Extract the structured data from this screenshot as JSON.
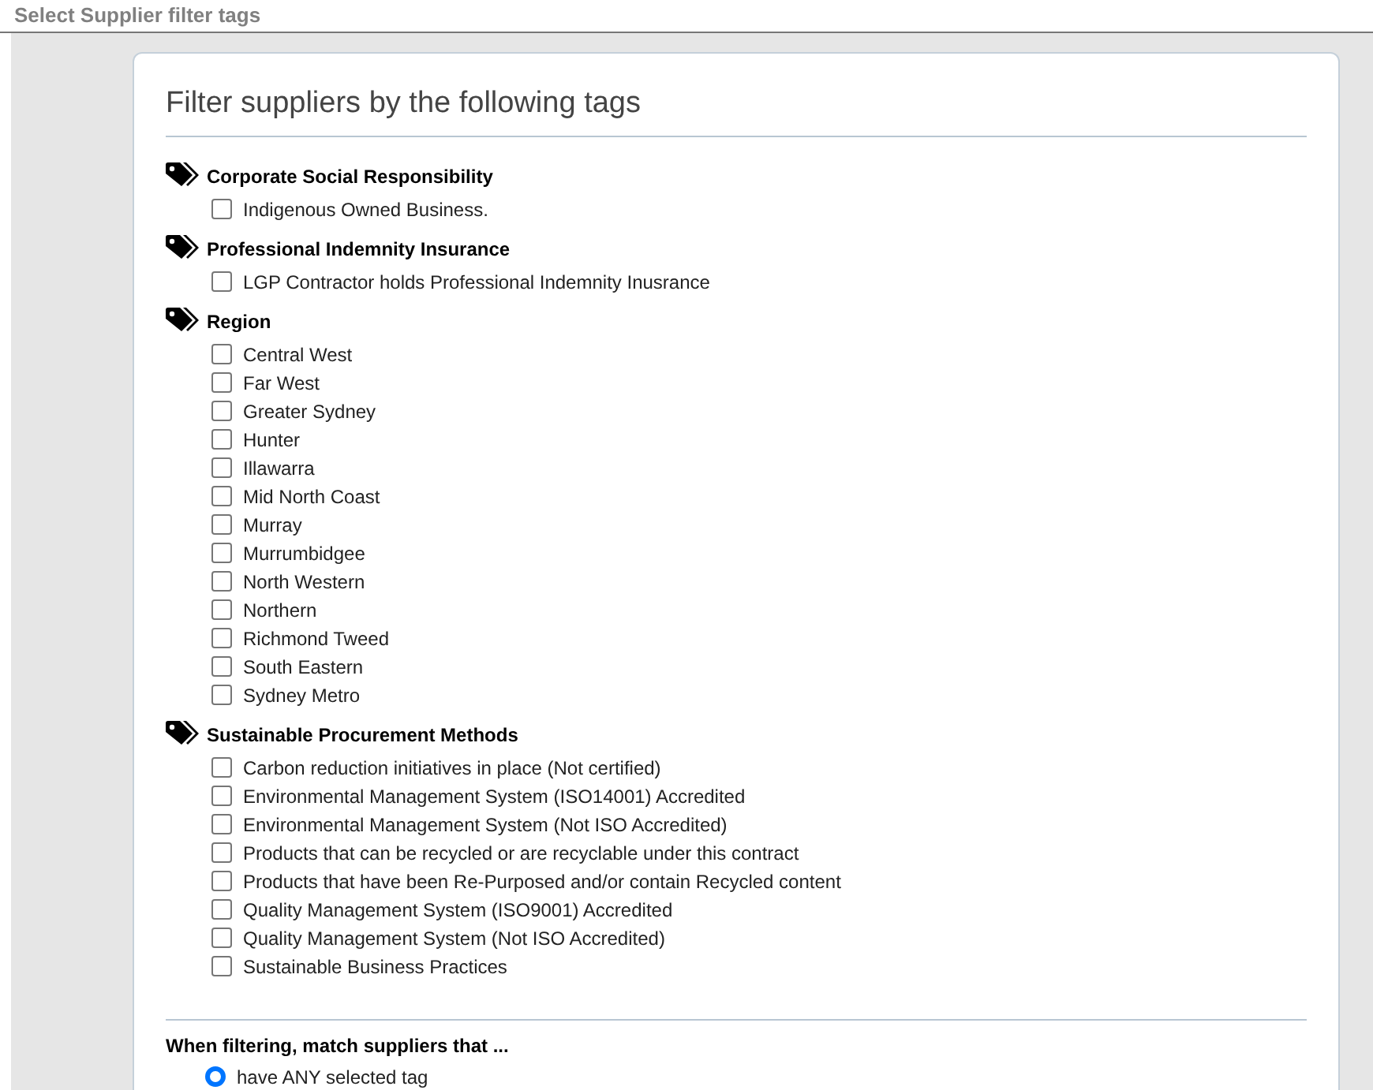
{
  "page_title": "Select Supplier filter tags",
  "card_title": "Filter suppliers by the following tags",
  "groups": [
    {
      "name": "Corporate Social Responsibility",
      "items": [
        {
          "label": "Indigenous Owned Business.",
          "checked": false
        }
      ]
    },
    {
      "name": "Professional Indemnity Insurance",
      "items": [
        {
          "label": "LGP Contractor holds Professional Indemnity Inusrance",
          "checked": false
        }
      ]
    },
    {
      "name": "Region",
      "items": [
        {
          "label": "Central West",
          "checked": false
        },
        {
          "label": "Far West",
          "checked": false
        },
        {
          "label": "Greater Sydney",
          "checked": false
        },
        {
          "label": "Hunter",
          "checked": false
        },
        {
          "label": "Illawarra",
          "checked": false
        },
        {
          "label": "Mid North Coast",
          "checked": false
        },
        {
          "label": "Murray",
          "checked": false
        },
        {
          "label": "Murrumbidgee",
          "checked": false
        },
        {
          "label": "North Western",
          "checked": false
        },
        {
          "label": "Northern",
          "checked": false
        },
        {
          "label": "Richmond Tweed",
          "checked": false
        },
        {
          "label": "South Eastern",
          "checked": false
        },
        {
          "label": "Sydney Metro",
          "checked": false
        }
      ]
    },
    {
      "name": "Sustainable Procurement Methods",
      "items": [
        {
          "label": "Carbon reduction initiatives in place (Not certified)",
          "checked": false
        },
        {
          "label": "Environmental Management System (ISO14001) Accredited",
          "checked": false
        },
        {
          "label": "Environmental Management System (Not ISO Accredited)",
          "checked": false
        },
        {
          "label": "Products that can be recycled or are recyclable under this contract",
          "checked": false
        },
        {
          "label": "Products that have been Re-Purposed and/or contain Recycled content",
          "checked": false
        },
        {
          "label": "Quality Management System (ISO9001) Accredited",
          "checked": false
        },
        {
          "label": "Quality Management System (Not ISO Accredited)",
          "checked": false
        },
        {
          "label": "Sustainable Business Practices",
          "checked": false
        }
      ]
    }
  ],
  "match": {
    "heading": "When filtering, match suppliers that ...",
    "options": [
      {
        "label": "have ANY selected tag",
        "selected": true
      }
    ]
  }
}
